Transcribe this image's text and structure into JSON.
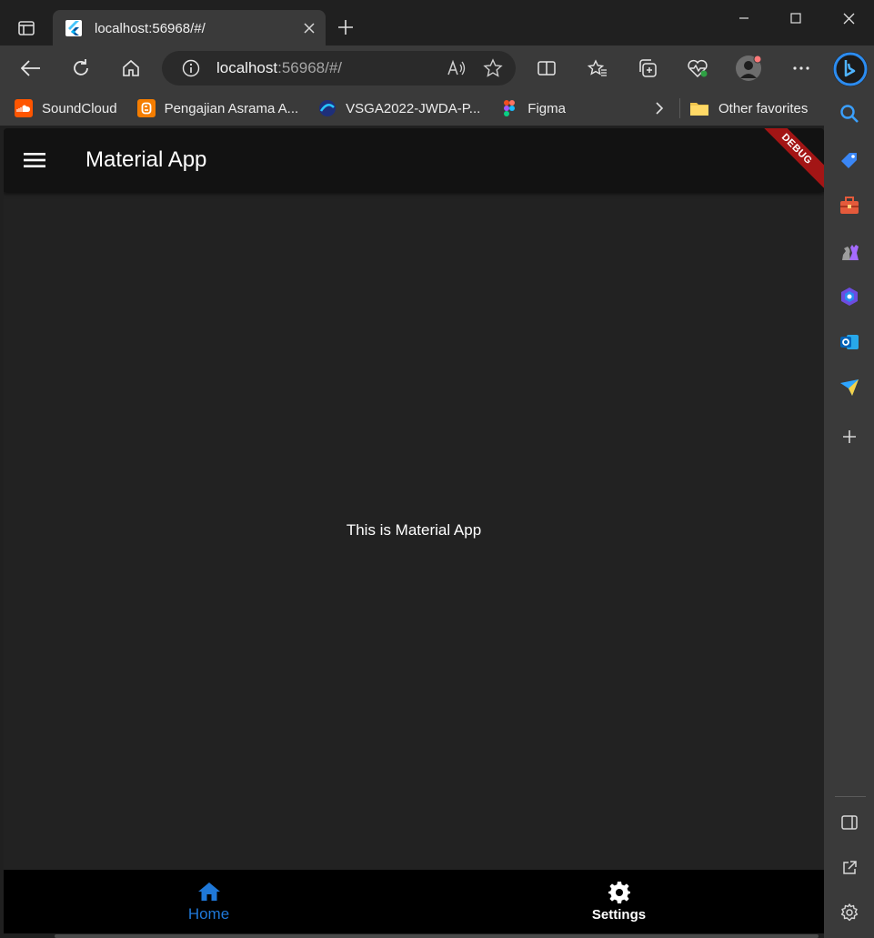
{
  "browser": {
    "tab": {
      "title": "localhost:56968/#/"
    },
    "address": {
      "host": "localhost",
      "rest": ":56968/#/"
    },
    "bookmarks": [
      {
        "label": "SoundCloud",
        "icon": "soundcloud-icon",
        "color": "#ff5500"
      },
      {
        "label": "Pengajian Asrama A...",
        "icon": "blogger-icon",
        "color": "#f57d00"
      },
      {
        "label": "VSGA2022-JWDA-P...",
        "icon": "digitalent-icon",
        "color": "#1e4fb0"
      },
      {
        "label": "Figma",
        "icon": "figma-icon",
        "color": "#a259ff"
      }
    ],
    "other_favorites": "Other favorites"
  },
  "app": {
    "title": "Material App",
    "debug_banner": "DEBUG",
    "body_text": "This is Material App",
    "nav": [
      {
        "label": "Home",
        "icon": "home-icon",
        "active": true
      },
      {
        "label": "Settings",
        "icon": "settings-icon",
        "active": false
      }
    ],
    "active_color": "#1f78d8"
  }
}
